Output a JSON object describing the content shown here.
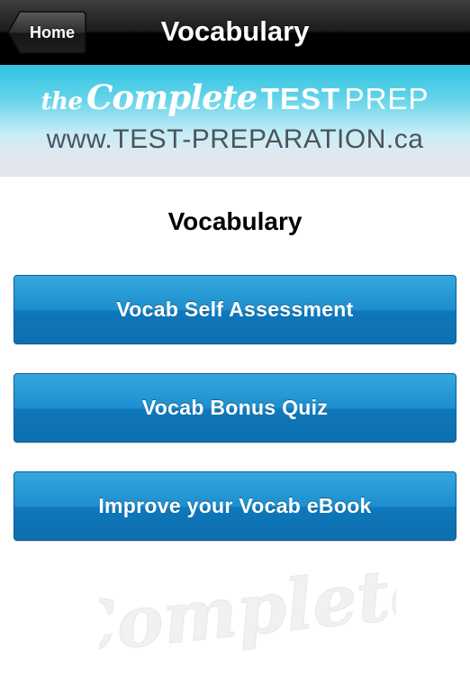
{
  "navbar": {
    "back_label": "Home",
    "title": "Vocabulary"
  },
  "banner": {
    "brand_the": "the",
    "brand_complete": "Complete",
    "brand_test": "TEST",
    "brand_prep": "PREP",
    "url": "www.TEST-PREPARATION.ca"
  },
  "main": {
    "section_title": "Vocabulary",
    "buttons": [
      {
        "label": "Vocab Self Assessment"
      },
      {
        "label": "Vocab Bonus Quiz"
      },
      {
        "label": "Improve your Vocab eBook"
      }
    ]
  },
  "watermark": {
    "text": "Complete"
  },
  "colors": {
    "navbar_bg": "#000000",
    "banner_top": "#2fc3e0",
    "button_blue": "#1d8ecf",
    "url_text": "#4a5560"
  }
}
